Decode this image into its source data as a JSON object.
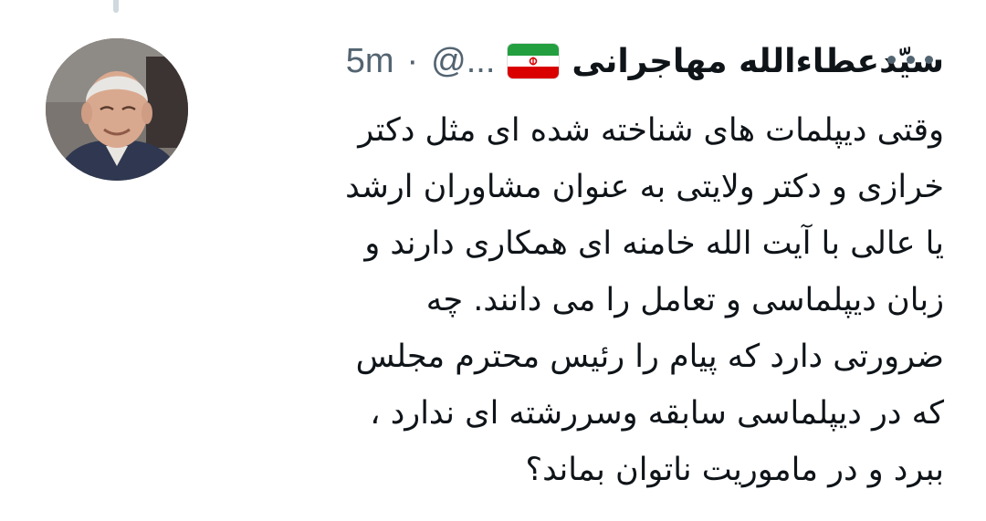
{
  "tweet": {
    "display_name": "سیّدعطاءالله مهاجرانی",
    "handle": "@...",
    "separator": "·",
    "time": "5m",
    "flag_icon": "iran-flag-icon",
    "more_icon": "more-options-icon",
    "body_lines": [
      "وقتی دیپلمات های شناخته شده ای مثل دکتر",
      "خرازی و دکتر ولایتی  به عنوان مشاوران ارشد",
      "یا عالی با آیت الله خامنه ای همکاری دارند و",
      "زبان دیپلماسی و تعامل را می دانند. چه",
      "ضرورتی دارد که پیام را رئیس محترم مجلس",
      "که در دیپلماسی  سابقه وسررشته ای ندارد ،",
      "ببرد و  در ماموریت ناتوان بماند؟"
    ]
  },
  "colors": {
    "text_primary": "#0f1419",
    "text_secondary": "#536471",
    "thread_line": "#cfd9de",
    "flag_green": "#239f40",
    "flag_white": "#ffffff",
    "flag_red": "#da0000"
  }
}
